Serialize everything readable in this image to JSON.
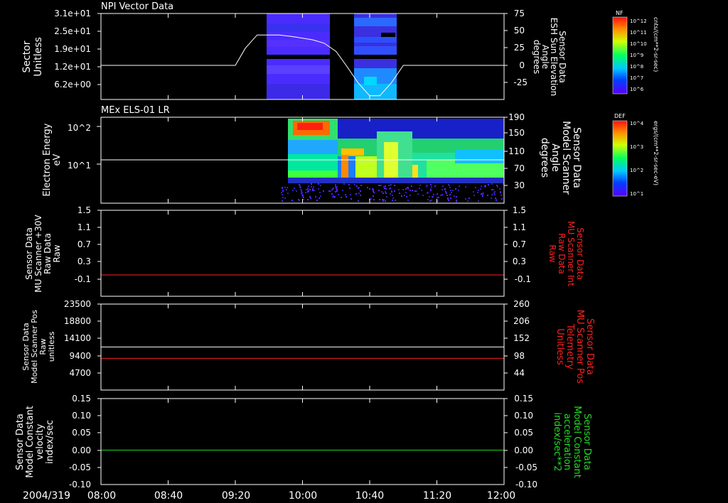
{
  "colors": {
    "background": "#000000",
    "axis": "#ffffff",
    "red_trace": "#ff2020",
    "green_trace": "#22dd22"
  },
  "time_axis": {
    "prefix": "2004/319",
    "ticks": [
      "08:00",
      "08:40",
      "09:20",
      "10:00",
      "10:40",
      "11:20",
      "12:00"
    ],
    "start_min": 480,
    "end_min": 720
  },
  "panels": [
    {
      "id": "npi",
      "title": "NPI Vector Data",
      "left_label": [
        "Sector",
        "Unitless"
      ],
      "left_ticks": [
        "3.1e+01",
        "2.5e+01",
        "1.9e+01",
        "1.2e+01",
        "6.2e+00"
      ],
      "right_ticks": [
        "75",
        "50",
        "25",
        "0",
        "-25"
      ],
      "right_label": [
        "Sensor Data",
        "ESH Sun Elevation",
        "Angle",
        "degrees"
      ],
      "right_label_color": "#ffffff",
      "colorbar": {
        "title": "NF",
        "unit": "cnts/(cm**2-sr-sec)",
        "ticks": [
          "10^12",
          "10^11",
          "10^10",
          "10^9",
          "10^8",
          "10^7",
          "10^6"
        ]
      }
    },
    {
      "id": "els",
      "title": "MEx ELS-01 LR",
      "left_label": [
        "Electron Energy",
        "eV"
      ],
      "left_ticks": [
        "10^2",
        "10^1"
      ],
      "right_ticks": [
        "190",
        "150",
        "110",
        "70",
        "30"
      ],
      "right_label": [
        "Sensor Data",
        "Model Scanner",
        "Angle",
        "degrees"
      ],
      "right_label_color": "#ffffff",
      "colorbar": {
        "title": "DEF",
        "unit": "ergs/(cm**2-sr-sec-eV)",
        "ticks": [
          "10^4",
          "10^3",
          "10^2",
          "10^1"
        ]
      }
    },
    {
      "id": "mu_raw",
      "title": "",
      "left_label": [
        "Sensor Data",
        "MU Scanner +30V",
        "Raw Data",
        "Raw"
      ],
      "left_ticks": [
        "1.5",
        "1.1",
        "0.7",
        "0.3",
        "-0.1"
      ],
      "right_ticks": [
        "1.5",
        "1.1",
        "0.7",
        "0.3",
        "-0.1"
      ],
      "right_label": [
        "Sensor Data",
        "MU Scanner Int",
        "Raw Data",
        "Raw"
      ],
      "right_label_color": "#ff2020"
    },
    {
      "id": "mu_pos",
      "title": "",
      "left_label": [
        "Sensor Data",
        "Model Scanner Pos",
        "Raw",
        "unitless"
      ],
      "left_ticks": [
        "23500",
        "18800",
        "14100",
        "9400",
        "4700"
      ],
      "right_ticks": [
        "260",
        "206",
        "152",
        "98",
        "44"
      ],
      "right_label": [
        "Sensor Data",
        "MU Scanner Pos",
        "Telemetry",
        "Unitless"
      ],
      "right_label_color": "#ff2020"
    },
    {
      "id": "model_const",
      "title": "",
      "left_label": [
        "Sensor Data",
        "Model Constant",
        "velocity",
        "index/sec"
      ],
      "left_ticks": [
        "0.15",
        "0.10",
        "0.05",
        "0.00",
        "-0.05",
        "-0.10"
      ],
      "right_ticks": [
        "0.15",
        "0.10",
        "0.05",
        "0.00",
        "-0.05",
        "-0.10"
      ],
      "right_label": [
        "Sensor Data",
        "Model Constant",
        "acceleration",
        "index/sec**2"
      ],
      "right_label_color": "#22dd22"
    }
  ],
  "chart_data": [
    {
      "type": "heatmap",
      "title": "NPI Vector Data",
      "ylabel": "Sector Unitless",
      "y2label": "Sensor Data ESH Sun Elevation Angle degrees",
      "y2lim": [
        -50,
        75
      ],
      "data_blocks": [
        {
          "t_start": "09:40",
          "t_end": "10:13"
        },
        {
          "t_start": "10:21",
          "t_end": "10:43"
        }
      ],
      "series": [
        {
          "name": "ESH Sun Elevation Angle",
          "x": [
            "08:00",
            "09:13",
            "09:20",
            "09:26",
            "09:33",
            "09:46",
            "09:53",
            "10:06",
            "10:13",
            "10:20",
            "10:26",
            "10:33",
            "10:40",
            "10:46",
            "10:53",
            "11:00",
            "11:06",
            "12:00"
          ],
          "y": [
            0,
            0,
            0,
            25,
            44,
            44,
            42,
            37,
            32,
            20,
            0,
            -25,
            -44,
            -44,
            -25,
            0,
            0,
            0
          ]
        }
      ]
    },
    {
      "type": "heatmap",
      "title": "MEx ELS-01 LR",
      "ylabel": "Electron Energy eV",
      "y2label": "Sensor Data Model Scanner Angle degrees",
      "y2lim": [
        10,
        190
      ],
      "data_start": "09:47",
      "data_end": "12:00",
      "series": [
        {
          "name": "Model Scanner Angle",
          "x": [
            "08:00",
            "12:00"
          ],
          "y": [
            90,
            90
          ]
        }
      ]
    },
    {
      "type": "line",
      "ylabel": "Sensor Data MU Scanner +30V Raw Data Raw",
      "ylim": [
        -0.3,
        1.5
      ],
      "series": [
        {
          "name": "MU Scanner Int Raw Data",
          "x": [
            "08:00",
            "12:00"
          ],
          "y": [
            0,
            0
          ]
        }
      ]
    },
    {
      "type": "line",
      "ylabel": "Sensor Data Model Scanner Pos Raw unitless",
      "ylim": [
        0,
        23500
      ],
      "y2label": "Sensor Data MU Scanner Pos Telemetry Unitless",
      "series": [
        {
          "name": "Model Scanner Pos",
          "x": [
            "08:00",
            "12:00"
          ],
          "y": [
            11800,
            11800
          ]
        },
        {
          "name": "MU Scanner Pos Telemetry",
          "x": [
            "08:00",
            "12:00"
          ],
          "y": [
            8700,
            8700
          ]
        }
      ]
    },
    {
      "type": "line",
      "ylabel": "Sensor Data Model Constant velocity index/sec",
      "ylim": [
        -0.1,
        0.15
      ],
      "y2label": "Sensor Data Model Constant acceleration index/sec**2",
      "series": [
        {
          "name": "Model Constant acceleration",
          "x": [
            "08:00",
            "12:00"
          ],
          "y": [
            0,
            0
          ]
        }
      ]
    }
  ]
}
